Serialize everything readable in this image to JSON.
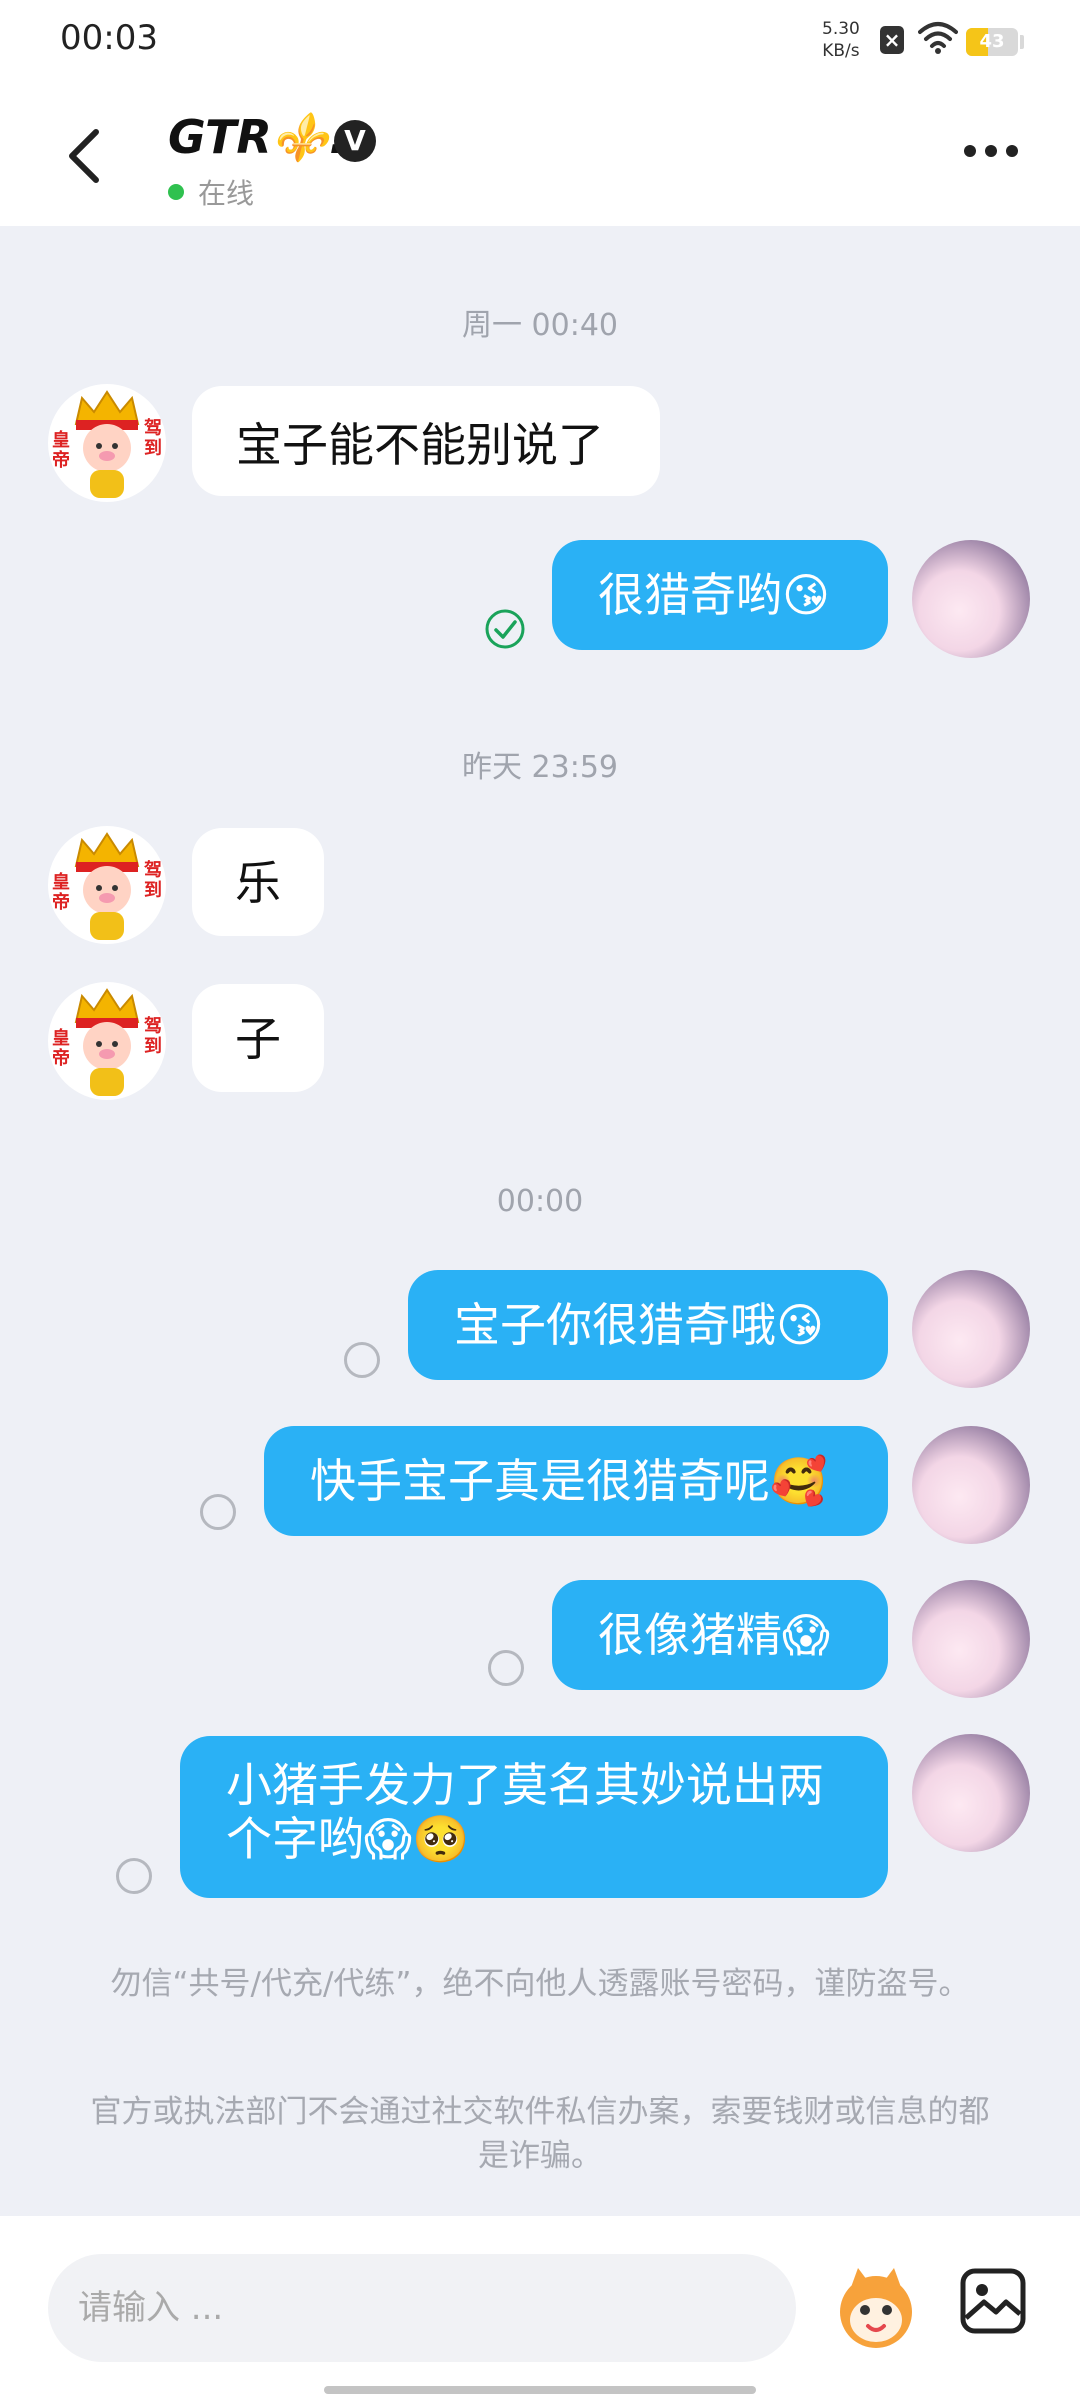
{
  "status_bar": {
    "time": "00:03",
    "net_speed_value": "5.30",
    "net_speed_unit": "KB/s",
    "sim_icon": "x-icon",
    "wifi_icon": "wifi-icon",
    "battery_level": "43",
    "battery_fraction": 0.43
  },
  "header": {
    "title": "GTR⚜️.",
    "verified_badge": "V",
    "status": "在线",
    "status_color": "#2fc14f"
  },
  "messages": [
    {
      "type": "timestamp",
      "text": "周一 00:40"
    },
    {
      "type": "received",
      "text": "宝子能不能别说了"
    },
    {
      "type": "sent",
      "text": "很猎奇哟😘",
      "status": "read"
    },
    {
      "type": "timestamp",
      "text": "昨天 23:59"
    },
    {
      "type": "received",
      "text": "乐"
    },
    {
      "type": "received",
      "text": "子"
    },
    {
      "type": "timestamp",
      "text": "00:00"
    },
    {
      "type": "sent",
      "text": "宝子你很猎奇哦😘",
      "status": "sent"
    },
    {
      "type": "sent",
      "text": "快手宝子真是很猎奇呢🥰",
      "status": "sent"
    },
    {
      "type": "sent",
      "text": "很像猪精😱",
      "status": "sent"
    },
    {
      "type": "sent",
      "text": "小猪手发力了莫名其妙说出两个字哟😱🥺",
      "status": "sent"
    }
  ],
  "notices": [
    "勿信“共号/代充/代练”，绝不向他人透露账号密码，谨防盗号。",
    "官方或执法部门不会通过社交软件私信办案，索要钱财或信息的都是诈骗。"
  ],
  "input": {
    "placeholder": "请输入 ..."
  },
  "colors": {
    "accent": "#2ab1f5",
    "background": "#eef0f6",
    "read_check": "#1aa35a"
  }
}
